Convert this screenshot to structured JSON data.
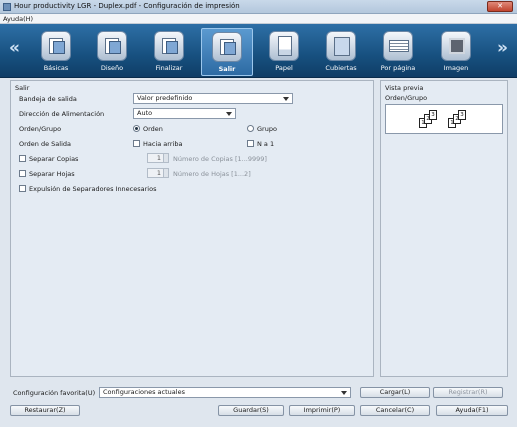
{
  "window": {
    "title": "Hour productivity LGR - Duplex.pdf - Configuración de impresión",
    "close": "✕"
  },
  "menu": {
    "help": "Ayuda(H)"
  },
  "tabs": [
    {
      "label": "Básicas",
      "icon": "basic-settings-icon"
    },
    {
      "label": "Diseño",
      "icon": "layout-icon"
    },
    {
      "label": "Finalizar",
      "icon": "finishing-icon"
    },
    {
      "label": "Salir",
      "icon": "output-icon",
      "active": true
    },
    {
      "label": "Papel",
      "icon": "paper-icon"
    },
    {
      "label": "Cubiertas",
      "icon": "covers-icon"
    },
    {
      "label": "Por página",
      "icon": "per-page-icon"
    },
    {
      "label": "Imagen",
      "icon": "image-icon"
    }
  ],
  "nav": {
    "left": "«",
    "right": "»"
  },
  "salir": {
    "section_title": "Salir",
    "output_tray_label": "Bandeja de salida",
    "output_tray_value": "Valor predefinido",
    "feed_direction_label": "Dirección de Alimentación",
    "feed_direction_value": "Auto",
    "order_group_label": "Orden/Grupo",
    "order_option": "Orden",
    "group_option": "Grupo",
    "output_order_label": "Orden de Salida",
    "face_up_label": "Hacia arriba",
    "n_to_1_label": "N a 1",
    "separate_copies_label": "Separar Copias",
    "copies_value": "1",
    "copies_range": "Número de Copias [1...9999]",
    "separate_sheets_label": "Separar Hojas",
    "sheets_value": "1",
    "sheets_range": "Número de Hojas [1...2]",
    "eject_separators_label": "Expulsión de Separadores Innecesarios"
  },
  "preview": {
    "title": "Vista previa",
    "subtitle": "Orden/Grupo",
    "pages": [
      "1",
      "2",
      "3",
      "1",
      "2",
      "3"
    ]
  },
  "favorites": {
    "label": "Configuración favorita(U)",
    "value": "Configuraciones actuales",
    "load": "Cargar(L)",
    "register": "Registrar(R)"
  },
  "footer": {
    "restore": "Restaurar(Z)",
    "save": "Guardar(S)",
    "print": "Imprimir(P)",
    "cancel": "Cancelar(C)",
    "help": "Ayuda(F1)"
  },
  "colors": {
    "toolbar": "#17507f",
    "panel": "#e4ebf3",
    "window": "#dfe6ee"
  }
}
